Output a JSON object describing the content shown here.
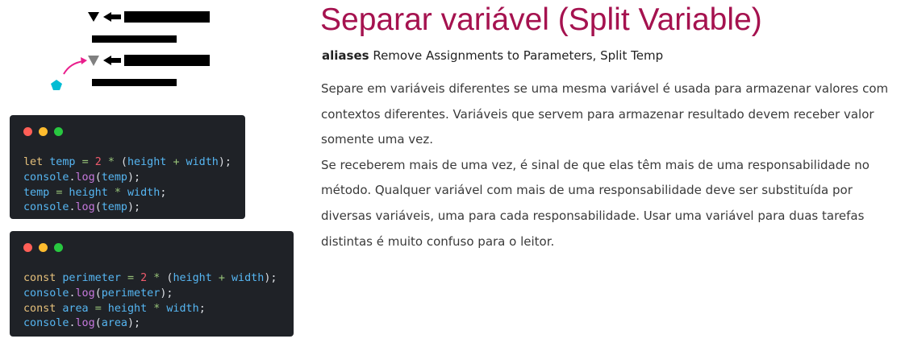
{
  "illustration": {
    "icons": [
      "down-triangle-icon",
      "left-arrow-icon",
      "curved-arrow-icon",
      "pentagon-icon"
    ],
    "colors": {
      "bars": "#000000",
      "triangle_top": "#000000",
      "triangle_bottom": "#808080",
      "arrow": "#e91e8c",
      "pentagon": "#00bcd4"
    }
  },
  "code_before": {
    "lines": [
      [
        {
          "t": "let",
          "c": "kw"
        },
        {
          "t": " temp ",
          "c": "id"
        },
        {
          "t": "=",
          "c": "op"
        },
        {
          "t": " ",
          "c": "id"
        },
        {
          "t": "2",
          "c": "num"
        },
        {
          "t": " ",
          "c": "id"
        },
        {
          "t": "*",
          "c": "op"
        },
        {
          "t": " (",
          "c": "pn"
        },
        {
          "t": "height",
          "c": "id"
        },
        {
          "t": " ",
          "c": "id"
        },
        {
          "t": "+",
          "c": "op"
        },
        {
          "t": " width",
          "c": "id"
        },
        {
          "t": ");",
          "c": "pn"
        }
      ],
      [
        {
          "t": "console",
          "c": "id"
        },
        {
          "t": ".",
          "c": "pn"
        },
        {
          "t": "log",
          "c": "fn"
        },
        {
          "t": "(",
          "c": "pn"
        },
        {
          "t": "temp",
          "c": "id"
        },
        {
          "t": ");",
          "c": "pn"
        }
      ],
      [
        {
          "t": "temp ",
          "c": "id"
        },
        {
          "t": "=",
          "c": "op"
        },
        {
          "t": " height ",
          "c": "id"
        },
        {
          "t": "*",
          "c": "op"
        },
        {
          "t": " width",
          "c": "id"
        },
        {
          "t": ";",
          "c": "pn"
        }
      ],
      [
        {
          "t": "console",
          "c": "id"
        },
        {
          "t": ".",
          "c": "pn"
        },
        {
          "t": "log",
          "c": "fn"
        },
        {
          "t": "(",
          "c": "pn"
        },
        {
          "t": "temp",
          "c": "id"
        },
        {
          "t": ");",
          "c": "pn"
        }
      ]
    ]
  },
  "code_after": {
    "lines": [
      [
        {
          "t": "const",
          "c": "kw"
        },
        {
          "t": " perimeter ",
          "c": "id"
        },
        {
          "t": "=",
          "c": "op"
        },
        {
          "t": " ",
          "c": "id"
        },
        {
          "t": "2",
          "c": "num"
        },
        {
          "t": " ",
          "c": "id"
        },
        {
          "t": "*",
          "c": "op"
        },
        {
          "t": " (",
          "c": "pn"
        },
        {
          "t": "height",
          "c": "id"
        },
        {
          "t": " ",
          "c": "id"
        },
        {
          "t": "+",
          "c": "op"
        },
        {
          "t": " width",
          "c": "id"
        },
        {
          "t": ");",
          "c": "pn"
        }
      ],
      [
        {
          "t": "console",
          "c": "id"
        },
        {
          "t": ".",
          "c": "pn"
        },
        {
          "t": "log",
          "c": "fn"
        },
        {
          "t": "(",
          "c": "pn"
        },
        {
          "t": "perimeter",
          "c": "id"
        },
        {
          "t": ");",
          "c": "pn"
        }
      ],
      [
        {
          "t": "const",
          "c": "kw"
        },
        {
          "t": " area ",
          "c": "id"
        },
        {
          "t": "=",
          "c": "op"
        },
        {
          "t": " height ",
          "c": "id"
        },
        {
          "t": "*",
          "c": "op"
        },
        {
          "t": " width",
          "c": "id"
        },
        {
          "t": ";",
          "c": "pn"
        }
      ],
      [
        {
          "t": "console",
          "c": "id"
        },
        {
          "t": ".",
          "c": "pn"
        },
        {
          "t": "log",
          "c": "fn"
        },
        {
          "t": "(",
          "c": "pn"
        },
        {
          "t": "area",
          "c": "id"
        },
        {
          "t": ");",
          "c": "pn"
        }
      ]
    ]
  },
  "content": {
    "title": "Separar variável (Split Variable)",
    "aliases_label": "aliases",
    "aliases_text": " Remove Assignments to Parameters, Split Temp",
    "paragraph_1": "Separe em variáveis diferentes se uma mesma variável é usada para armazenar valores com contextos diferentes. Variáveis que servem para armazenar resultado devem receber valor somente uma vez.",
    "paragraph_2": "Se receberem mais de uma vez, é sinal de que elas têm mais de uma responsabilidade no método. Qualquer variável com mais de uma responsabilidade deve ser substituída por diversas variáveis, uma para cada responsabilidade. Usar uma variável para duas tarefas distintas é muito confuso para o leitor."
  },
  "colors": {
    "title": "#a5124f",
    "code_bg": "#1f2227",
    "code_identifier": "#56b6f2",
    "code_keyword": "#e5c07b",
    "code_number": "#ef5b6d",
    "code_operator": "#98c379",
    "code_function": "#c678dd",
    "code_punctuation": "#dcdfe4"
  }
}
